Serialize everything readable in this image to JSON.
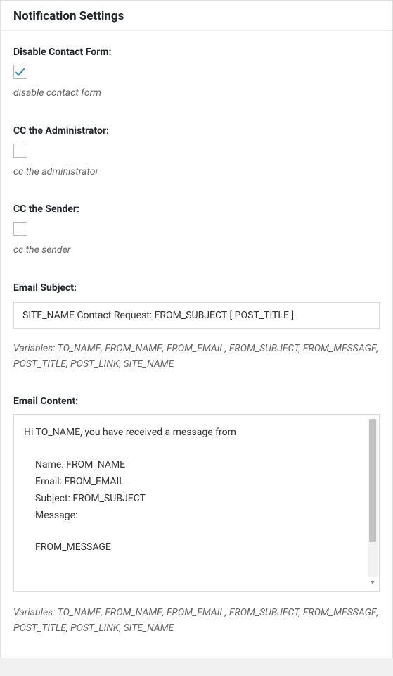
{
  "panel": {
    "title": "Notification Settings"
  },
  "fields": {
    "disable_contact_form": {
      "label": "Disable Contact Form:",
      "checked": true,
      "hint": "disable contact form"
    },
    "cc_admin": {
      "label": "CC the Administrator:",
      "checked": false,
      "hint": "cc the administrator"
    },
    "cc_sender": {
      "label": "CC the Sender:",
      "checked": false,
      "hint": "cc the sender"
    },
    "email_subject": {
      "label": "Email Subject:",
      "value": "SITE_NAME Contact Request: FROM_SUBJECT [ POST_TITLE ]",
      "hint": "Variables: TO_NAME, FROM_NAME, FROM_EMAIL, FROM_SUBJECT, FROM_MESSAGE, POST_TITLE, POST_LINK, SITE_NAME"
    },
    "email_content": {
      "label": "Email Content:",
      "lines": {
        "l0": "Hi TO_NAME, you have received a message from",
        "l1": "Name: FROM_NAME",
        "l2": "Email: FROM_EMAIL",
        "l3": "Subject: FROM_SUBJECT",
        "l4": "Message:",
        "l5": "FROM_MESSAGE"
      },
      "hint": "Variables: TO_NAME, FROM_NAME, FROM_EMAIL, FROM_SUBJECT, FROM_MESSAGE, POST_TITLE, POST_LINK, SITE_NAME"
    }
  }
}
